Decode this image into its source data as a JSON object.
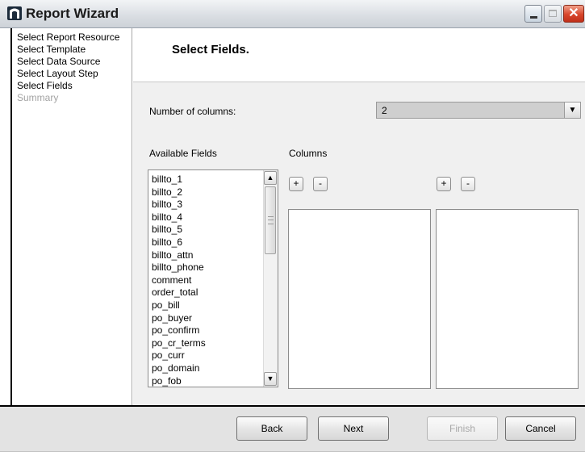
{
  "window": {
    "title": "Report Wizard",
    "icon": "app-logo-icon"
  },
  "steps": [
    {
      "label": "Select Report Resource",
      "enabled": true
    },
    {
      "label": "Select Template",
      "enabled": true
    },
    {
      "label": "Select Data Source",
      "enabled": true
    },
    {
      "label": "Select Layout Step",
      "enabled": true
    },
    {
      "label": "Select Fields",
      "enabled": true
    },
    {
      "label": "Summary",
      "enabled": false
    }
  ],
  "header": {
    "title": "Select Fields."
  },
  "form": {
    "columns_label": "Number of columns:",
    "columns_value": "2",
    "available_label": "Available Fields",
    "columns_heading": "Columns",
    "add_label": "+",
    "remove_label": "-"
  },
  "available_fields": [
    "billto_1",
    "billto_2",
    "billto_3",
    "billto_4",
    "billto_5",
    "billto_6",
    "billto_attn",
    "billto_phone",
    "comment",
    "order_total",
    "po_bill",
    "po_buyer",
    "po_confirm",
    "po_cr_terms",
    "po_curr",
    "po_domain",
    "po_fob"
  ],
  "buttons": {
    "back": "Back",
    "next": "Next",
    "finish": "Finish",
    "cancel": "Cancel"
  },
  "colors": {
    "close_button": "#d8452b",
    "disabled_text": "#a3a3a3"
  }
}
